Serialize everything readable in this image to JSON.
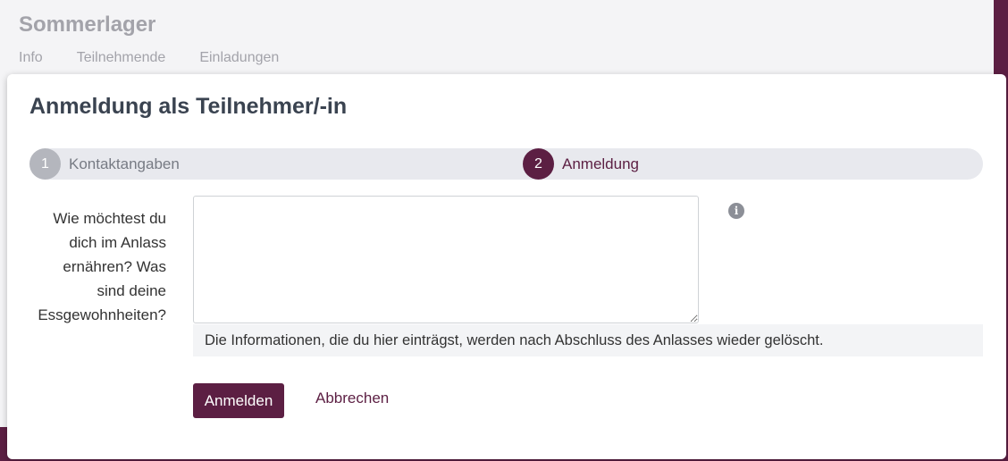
{
  "background": {
    "title": "Sommerlager",
    "tabs": [
      "Info",
      "Teilnehmende",
      "Einladungen"
    ]
  },
  "modal": {
    "title": "Anmeldung als Teilnehmer/-in",
    "steps": [
      {
        "number": "1",
        "label": "Kontaktangaben",
        "state": "completed"
      },
      {
        "number": "2",
        "label": "Anmeldung",
        "state": "active"
      }
    ],
    "field": {
      "label": "Wie möchtest du dich im Anlass ernähren? Was sind deine Essgewohnheiten?",
      "value": "",
      "info_icon": "info-circle-icon",
      "help": "Die Informationen, die du hier einträgst, werden nach Abschluss des Anlasses wieder gelöscht."
    },
    "buttons": {
      "submit": "Anmelden",
      "cancel": "Abbrechen"
    }
  },
  "colors": {
    "brand": "#5c1f43",
    "stepper_bg": "#e8e9ee",
    "help_bg": "#f3f4f6"
  }
}
